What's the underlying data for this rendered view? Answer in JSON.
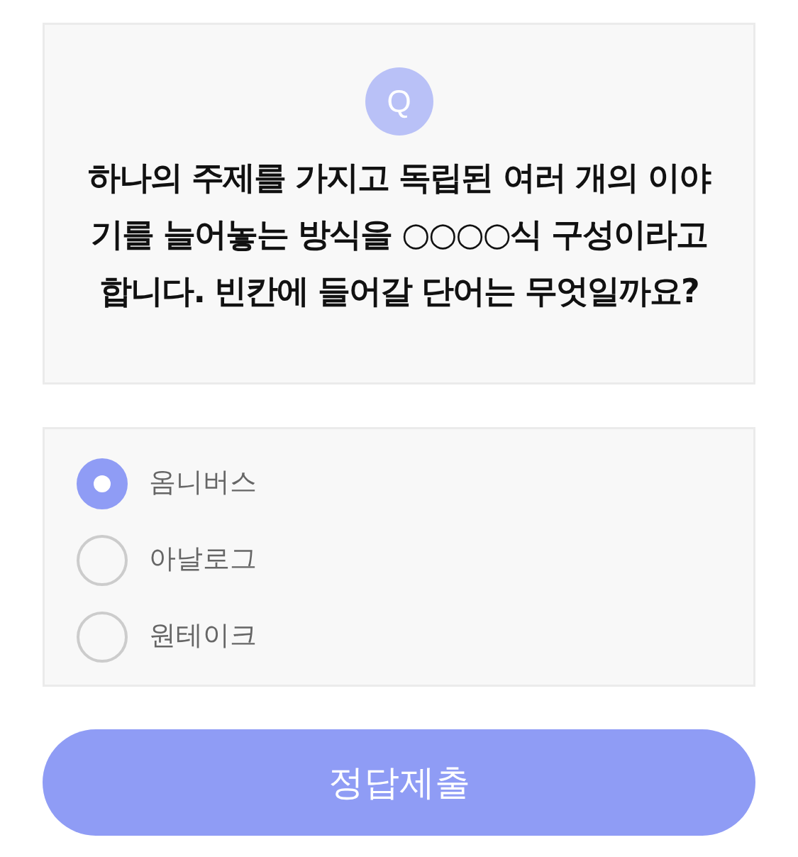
{
  "question": {
    "badge": "Q",
    "text": "하나의 주제를 가지고 독립된 여러 개의 이야기를 늘어놓는 방식을 ○○○○식 구성이라고 합니다. 빈칸에 들어갈 단어는 무엇일까요?"
  },
  "options": [
    {
      "label": "옴니버스",
      "selected": true
    },
    {
      "label": "아날로그",
      "selected": false
    },
    {
      "label": "원테이크",
      "selected": false
    }
  ],
  "submit_button": {
    "label": "정답제출"
  }
}
